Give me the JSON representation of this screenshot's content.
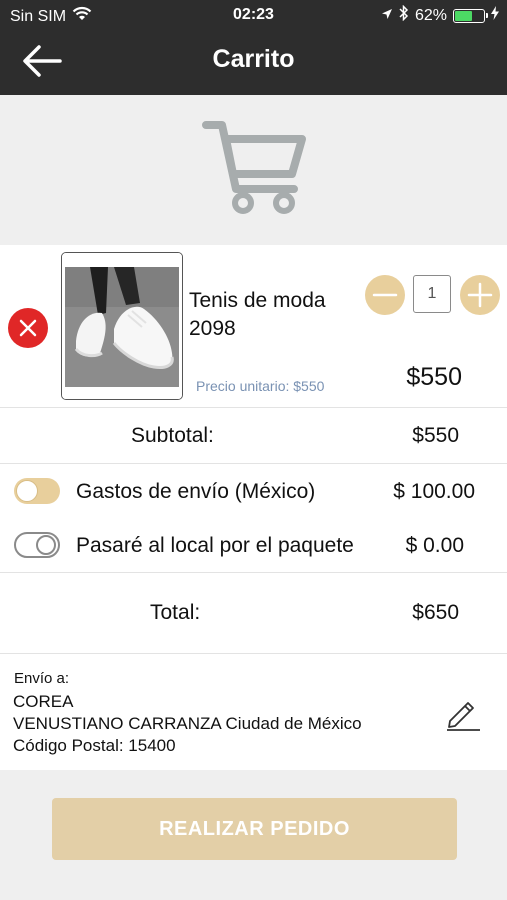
{
  "status_bar": {
    "carrier": "Sin SIM",
    "time": "02:23",
    "battery": "62%",
    "battery_level": 0.62,
    "icons": [
      "wifi-icon",
      "location-arrow-icon",
      "bluetooth-icon",
      "battery-icon",
      "charging-bolt-icon"
    ]
  },
  "navbar": {
    "title": "Carrito",
    "back_icon": "arrow-left-icon"
  },
  "header": {
    "icon": "shopping-cart-icon"
  },
  "cart_item": {
    "name": "Tenis de moda 2098",
    "unit_price_label": "Precio unitario: $550",
    "quantity": "1",
    "line_total": "$550",
    "image_icon": "white-sneakers-photo",
    "remove_icon": "close-icon"
  },
  "summary": {
    "subtotal_label": "Subtotal:",
    "subtotal_value": "$550",
    "shipping_option_label": "Gastos de envío (México)",
    "shipping_option_value": "$ 100.00",
    "shipping_option_on": true,
    "pickup_option_label": "Pasaré al local por el paquete",
    "pickup_option_value": "$ 0.00",
    "pickup_option_on": false,
    "total_label": "Total:",
    "total_value": "$650"
  },
  "address": {
    "heading": "Envío a:",
    "name": "COREA",
    "line2": "VENUSTIANO CARRANZA Ciudad de México",
    "postal": "Código Postal: 15400",
    "edit_icon": "pencil-icon"
  },
  "actions": {
    "place_order_label": "REALIZAR PEDIDO"
  },
  "colors": {
    "bar": "#2d2d2d",
    "accent_gold": "#e8cf9c",
    "button_disabled": "#e3cfa7",
    "remove_red": "#e02727",
    "unit_price_blue": "#7a92b3",
    "cart_icon_gray": "#a7acad"
  }
}
